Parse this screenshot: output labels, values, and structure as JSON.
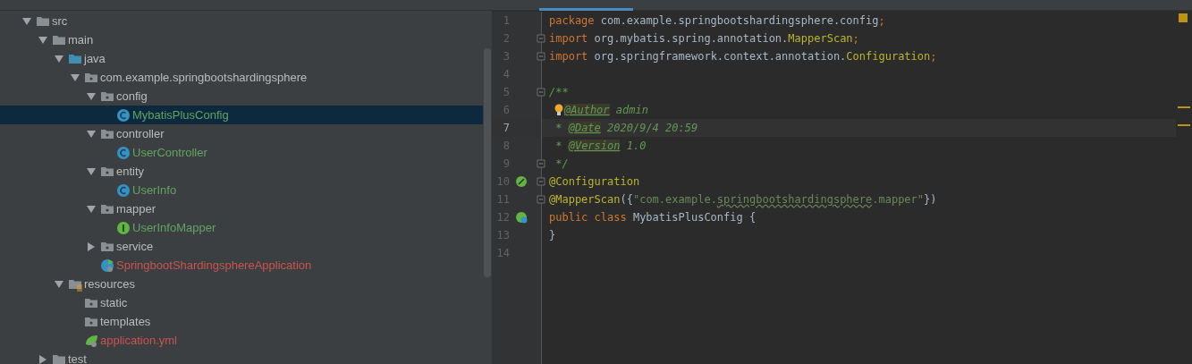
{
  "project_tree": {
    "items": [
      {
        "label": "src",
        "kind": "folder",
        "expanded": true,
        "selected": false,
        "children": [
          {
            "label": "main",
            "kind": "folder",
            "expanded": true,
            "selected": false,
            "children": [
              {
                "label": "java",
                "kind": "source-folder",
                "expanded": true,
                "selected": false,
                "children": [
                  {
                    "label": "com.example.springbootshardingsphere",
                    "kind": "package",
                    "expanded": true,
                    "selected": false,
                    "children": [
                      {
                        "label": "config",
                        "kind": "package",
                        "expanded": true,
                        "selected": false,
                        "children": [
                          {
                            "label": "MybatisPlusConfig",
                            "kind": "class",
                            "selected": true,
                            "color": "#62a362"
                          }
                        ]
                      },
                      {
                        "label": "controller",
                        "kind": "package",
                        "expanded": true,
                        "selected": false,
                        "children": [
                          {
                            "label": "UserController",
                            "kind": "class",
                            "selected": false,
                            "color": "#62a362"
                          }
                        ]
                      },
                      {
                        "label": "entity",
                        "kind": "package",
                        "expanded": true,
                        "selected": false,
                        "children": [
                          {
                            "label": "UserInfo",
                            "kind": "class",
                            "selected": false,
                            "color": "#62a362"
                          }
                        ]
                      },
                      {
                        "label": "mapper",
                        "kind": "package",
                        "expanded": true,
                        "selected": false,
                        "children": [
                          {
                            "label": "UserInfoMapper",
                            "kind": "interface",
                            "selected": false,
                            "color": "#62a362"
                          }
                        ]
                      },
                      {
                        "label": "service",
                        "kind": "package",
                        "expanded": false,
                        "selected": false
                      },
                      {
                        "label": "SpringbootShardingsphereApplication",
                        "kind": "boot-class",
                        "selected": false,
                        "color": "#c75450"
                      }
                    ]
                  }
                ]
              },
              {
                "label": "resources",
                "kind": "resource-folder",
                "expanded": true,
                "selected": false,
                "children": [
                  {
                    "label": "static",
                    "kind": "package",
                    "selected": false
                  },
                  {
                    "label": "templates",
                    "kind": "package",
                    "selected": false
                  },
                  {
                    "label": "application.yml",
                    "kind": "yml",
                    "selected": false,
                    "color": "#c75450"
                  }
                ]
              }
            ]
          },
          {
            "label": "test",
            "kind": "folder",
            "expanded": false,
            "selected": false
          }
        ]
      }
    ]
  },
  "editor": {
    "lines": [
      {
        "number": "1",
        "current": false,
        "tokens": [
          {
            "kind": "keyword",
            "text": "package"
          },
          {
            "kind": "plain",
            "text": " com.example.springbootshardingsphere.config"
          },
          {
            "kind": "keyword",
            "text": ";"
          }
        ]
      },
      {
        "number": "2",
        "current": false,
        "fold": true,
        "tokens": [
          {
            "kind": "keyword",
            "text": "import"
          },
          {
            "kind": "plain",
            "text": " org.mybatis.spring.annotation."
          },
          {
            "kind": "annotation",
            "text": "MapperScan"
          },
          {
            "kind": "keyword",
            "text": ";"
          }
        ]
      },
      {
        "number": "3",
        "current": false,
        "fold": true,
        "tokens": [
          {
            "kind": "keyword",
            "text": "import"
          },
          {
            "kind": "plain",
            "text": " org.springframework.context.annotation."
          },
          {
            "kind": "annotation",
            "text": "Configuration"
          },
          {
            "kind": "keyword",
            "text": ";"
          }
        ]
      },
      {
        "number": "4",
        "current": false
      },
      {
        "number": "5",
        "current": false,
        "fold": true,
        "tokens": [
          {
            "kind": "doc",
            "text": "/**"
          }
        ]
      },
      {
        "number": "6",
        "current": false,
        "bulb": true,
        "tokens": [
          {
            "kind": "doctag",
            "text": "@Author"
          },
          {
            "kind": "doc",
            "text": " admin"
          }
        ]
      },
      {
        "number": "7",
        "current": true,
        "tokens": [
          {
            "kind": "doc",
            "text": " * "
          },
          {
            "kind": "doctag",
            "text": "@Date"
          },
          {
            "kind": "doc",
            "text": " 2020/9/4 20:59"
          }
        ]
      },
      {
        "number": "8",
        "current": false,
        "tokens": [
          {
            "kind": "doc",
            "text": " * "
          },
          {
            "kind": "doctag",
            "text": "@Version"
          },
          {
            "kind": "doc",
            "text": " 1.0"
          }
        ]
      },
      {
        "number": "9",
        "current": false,
        "fold": true,
        "tokens": [
          {
            "kind": "doc",
            "text": " */"
          }
        ]
      },
      {
        "number": "10",
        "current": false,
        "fold": true,
        "kind": "bean",
        "tokens": [
          {
            "kind": "annotation",
            "text": "@Configuration"
          }
        ]
      },
      {
        "number": "11",
        "current": false,
        "fold": true,
        "tokens": [
          {
            "kind": "annotation",
            "text": "@MapperScan"
          },
          {
            "kind": "plain",
            "text": "({"
          },
          {
            "kind": "string",
            "text": "\"com.example."
          },
          {
            "kind": "typo",
            "text": "springbootshardingsphere"
          },
          {
            "kind": "string",
            "text": ".mapper\""
          },
          {
            "kind": "plain",
            "text": "})"
          }
        ]
      },
      {
        "number": "12",
        "current": false,
        "kind": "bean-class",
        "tokens": [
          {
            "kind": "keyword",
            "text": "public class "
          },
          {
            "kind": "plain",
            "text": "MybatisPlusConfig {"
          }
        ]
      },
      {
        "number": "13",
        "current": false,
        "tokens": [
          {
            "kind": "plain",
            "text": "}"
          }
        ]
      },
      {
        "number": "14",
        "current": false
      }
    ]
  }
}
